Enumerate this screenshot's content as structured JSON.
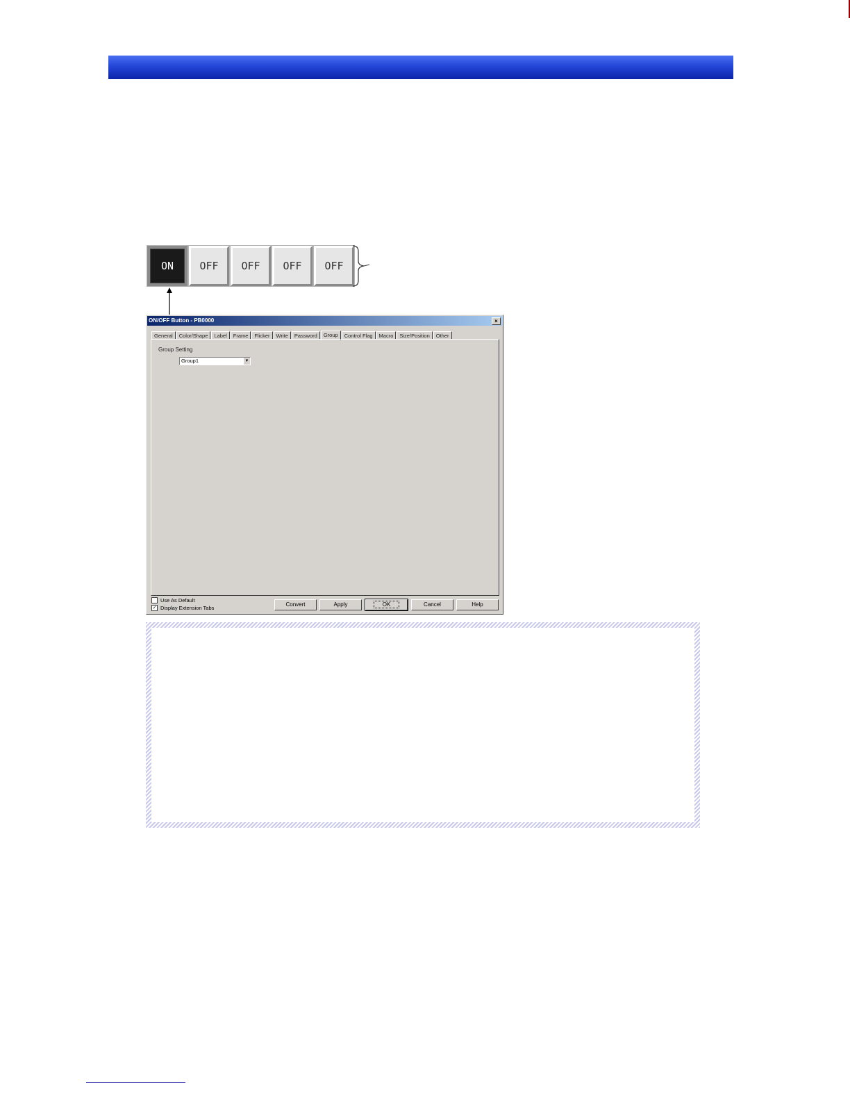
{
  "buttons": {
    "states": [
      "ON",
      "OFF",
      "OFF",
      "OFF",
      "OFF"
    ]
  },
  "dialog": {
    "title": "ON/OFF Button - PB0000",
    "tabs": [
      "General",
      "Color/Shape",
      "Label",
      "Frame",
      "Flicker",
      "Write",
      "Password",
      "Group",
      "Control Flag",
      "Macro",
      "Size/Position",
      "Other"
    ],
    "active_tab": "Group",
    "group_setting_label": "Group Setting",
    "group_select_value": "Group1",
    "use_as_default_label": "Use As Default",
    "use_as_default_checked": false,
    "display_extension_tabs_label": "Display Extension Tabs",
    "display_extension_tabs_checked": true,
    "convert_label": "Convert",
    "apply_label": "Apply",
    "ok_label": "OK",
    "cancel_label": "Cancel",
    "help_label": "Help",
    "check_mark": "✓",
    "close_glyph": "×",
    "dropdown_glyph": "▼"
  },
  "colors": {
    "header_bar": "#2346d8",
    "note_border": "#c8c8ea"
  }
}
